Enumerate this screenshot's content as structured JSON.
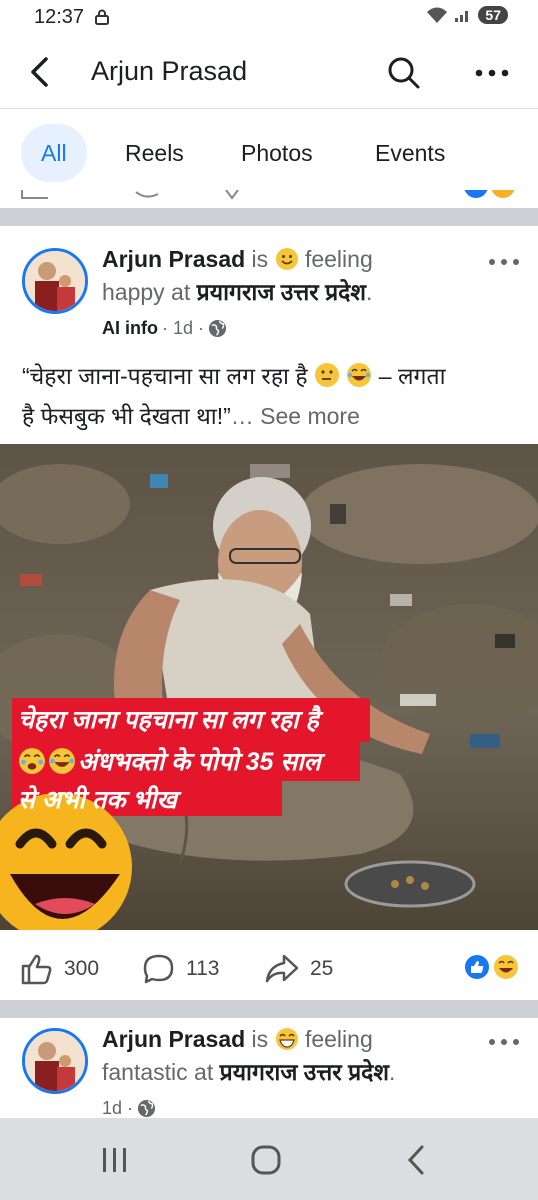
{
  "status_bar": {
    "time": "12:37",
    "battery": "57"
  },
  "header": {
    "title": "Arjun Prasad"
  },
  "tabs": [
    "All",
    "Reels",
    "Photos",
    "Events"
  ],
  "posts": [
    {
      "author": "Arjun Prasad",
      "is": "is",
      "feeling": "feeling",
      "mood_line": "happy at",
      "place": "प्रयागराज उत्तर प्रदेश",
      "period": ".",
      "meta_label": "AI info",
      "meta_time": " · 1d · ",
      "text_line1": "“चेहरा जाना-पहचाना सा लग रहा है",
      "text_line1_end": " – लगता",
      "text_line2": "है फेसबुक भी देखता था!”",
      "see_more": "… See more",
      "image_caption_line1": "चेहरा जाना पहचाना सा लग रहा है",
      "image_caption_line2": "अंधभक्तो के पोपो 35 साल",
      "image_caption_line3": "से अभी तक भीख",
      "likes": "300",
      "comments": "113",
      "shares": "25"
    },
    {
      "author": "Arjun Prasad",
      "is": "is",
      "feeling": "feeling",
      "mood_line": "fantastic at",
      "place": "प्रयागराज उत्तर प्रदेश",
      "period": ".",
      "meta_time": "1d · "
    }
  ],
  "colors": {
    "accent": "#1877f2",
    "caption_bg": "#e3162c",
    "divider": "#cdd0d4"
  }
}
